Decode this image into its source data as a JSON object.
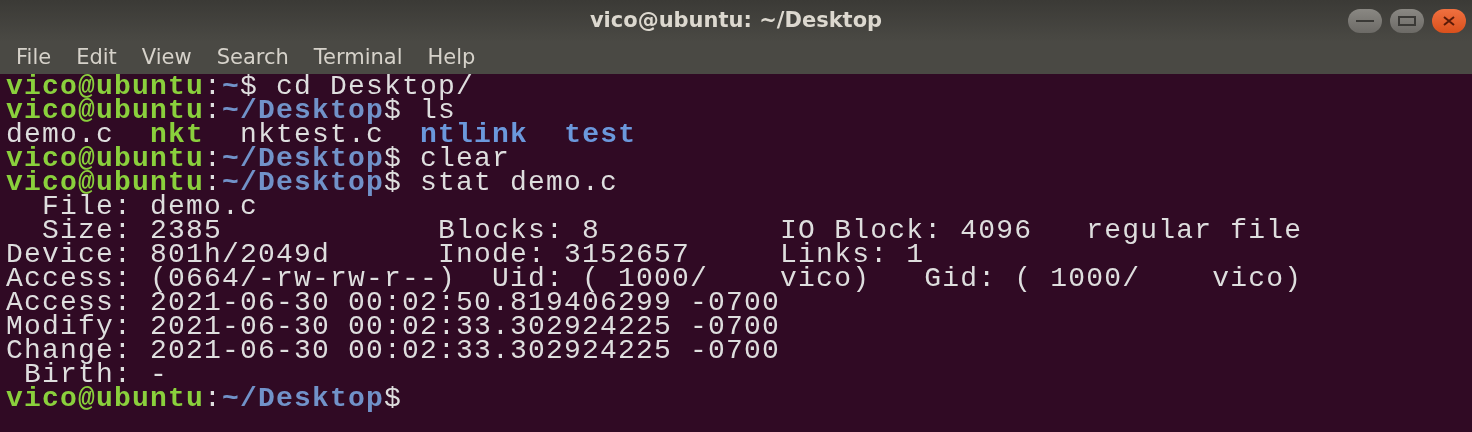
{
  "window": {
    "title": "vico@ubuntu: ~/Desktop"
  },
  "menu": [
    "File",
    "Edit",
    "View",
    "Search",
    "Terminal",
    "Help"
  ],
  "lines": [
    [
      {
        "kind": "user",
        "text": "vico@ubuntu"
      },
      {
        "kind": "plain",
        "text": ":"
      },
      {
        "kind": "path",
        "text": "~"
      },
      {
        "kind": "plain",
        "text": "$ cd Desktop/"
      }
    ],
    [
      {
        "kind": "user",
        "text": "vico@ubuntu"
      },
      {
        "kind": "plain",
        "text": ":"
      },
      {
        "kind": "path",
        "text": "~/Desktop"
      },
      {
        "kind": "plain",
        "text": "$ ls"
      }
    ],
    [
      {
        "kind": "plain",
        "text": "demo.c  "
      },
      {
        "kind": "exec",
        "text": "nkt"
      },
      {
        "kind": "plain",
        "text": "  nktest.c  "
      },
      {
        "kind": "dir",
        "text": "ntlink  "
      },
      {
        "kind": "dir",
        "text": "test"
      }
    ],
    [
      {
        "kind": "user",
        "text": "vico@ubuntu"
      },
      {
        "kind": "plain",
        "text": ":"
      },
      {
        "kind": "path",
        "text": "~/Desktop"
      },
      {
        "kind": "plain",
        "text": "$ clear"
      }
    ],
    [
      {
        "kind": "user",
        "text": "vico@ubuntu"
      },
      {
        "kind": "plain",
        "text": ":"
      },
      {
        "kind": "path",
        "text": "~/Desktop"
      },
      {
        "kind": "plain",
        "text": "$ stat demo.c"
      }
    ],
    [
      {
        "kind": "plain",
        "text": "  File: demo.c"
      }
    ],
    [
      {
        "kind": "plain",
        "text": "  Size: 2385            Blocks: 8          IO Block: 4096   regular file"
      }
    ],
    [
      {
        "kind": "plain",
        "text": "Device: 801h/2049d      Inode: 3152657     Links: 1"
      }
    ],
    [
      {
        "kind": "plain",
        "text": "Access: (0664/-rw-rw-r--)  Uid: ( 1000/    vico)   Gid: ( 1000/    vico)"
      }
    ],
    [
      {
        "kind": "plain",
        "text": "Access: 2021-06-30 00:02:50.819406299 -0700"
      }
    ],
    [
      {
        "kind": "plain",
        "text": "Modify: 2021-06-30 00:02:33.302924225 -0700"
      }
    ],
    [
      {
        "kind": "plain",
        "text": "Change: 2021-06-30 00:02:33.302924225 -0700"
      }
    ],
    [
      {
        "kind": "plain",
        "text": " Birth: -"
      }
    ],
    [
      {
        "kind": "user",
        "text": "vico@ubuntu"
      },
      {
        "kind": "plain",
        "text": ":"
      },
      {
        "kind": "path",
        "text": "~/Desktop"
      },
      {
        "kind": "plain",
        "text": "$"
      }
    ]
  ]
}
